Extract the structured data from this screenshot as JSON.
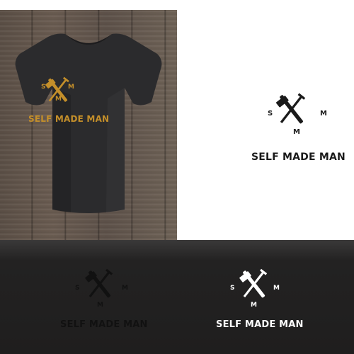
{
  "brand": {
    "name": "SELF MADE MAN",
    "monogram": {
      "left": "S",
      "right": "M",
      "bottom": "M"
    }
  },
  "colors": {
    "gold": "#c48f2a",
    "black": "#1a1a1a",
    "white": "#ffffff",
    "shirt": "#2b2b2d",
    "dark_background": "#1f1e1e"
  },
  "icons": [
    "hammer-icon",
    "nail-icon"
  ],
  "variants": [
    "gold-on-shirt",
    "black-on-white",
    "black-on-dark",
    "white-on-dark"
  ]
}
